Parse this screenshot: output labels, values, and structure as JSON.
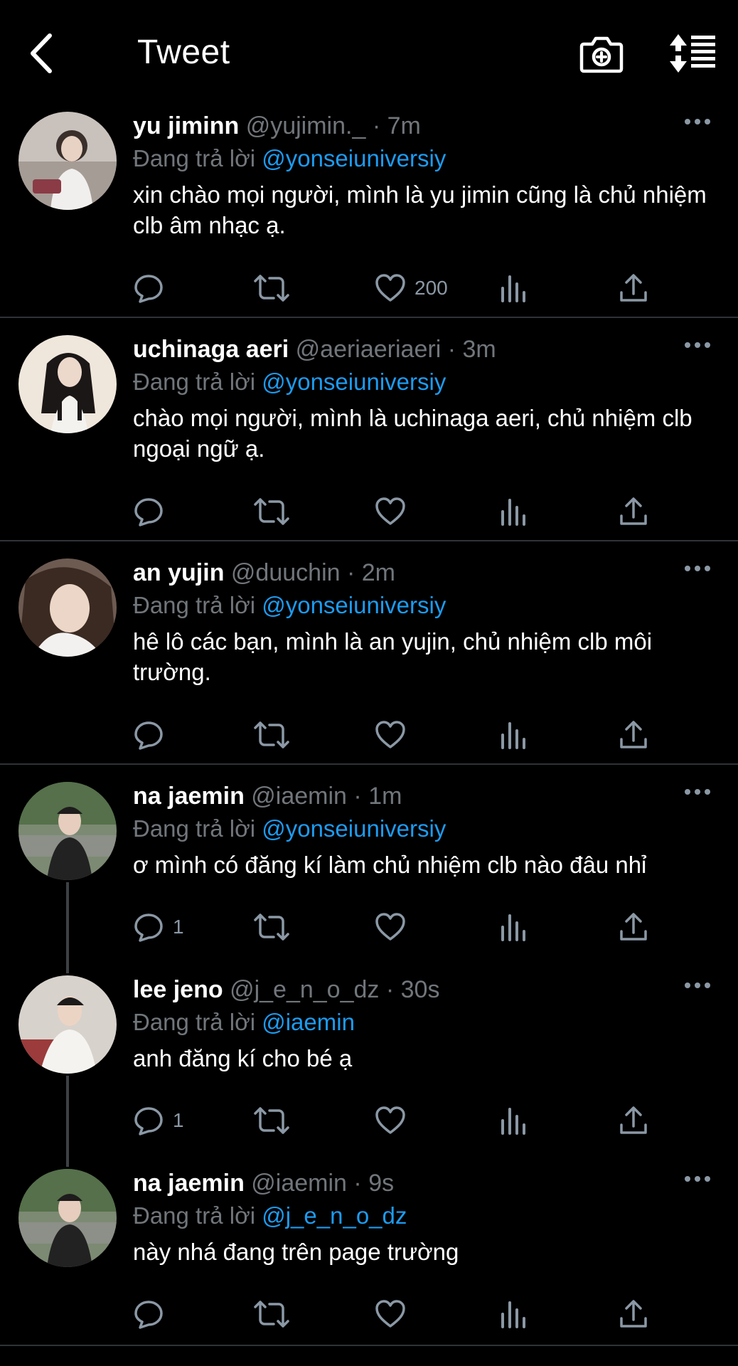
{
  "header": {
    "title": "Tweet",
    "back_icon": "back-arrow-icon",
    "camera_icon": "camera-plus-icon",
    "sort_icon": "sort-list-icon"
  },
  "colors": {
    "background": "#000000",
    "text": "#ffffff",
    "secondary": "#71767b",
    "link": "#1d9bf0",
    "divider": "#2f3336"
  },
  "tweets": [
    {
      "name": "yu jiminn",
      "handle": "@yujimin._",
      "time": "· 7m",
      "reply_prefix": "Đang trả lời",
      "reply_to": "@yonseiuniversiy",
      "text": "xin chào mọi người, mình là yu jimin cũng là chủ nhiệm clb âm nhạc ạ.",
      "reply_count": "",
      "retweet_count": "",
      "like_count": "200"
    },
    {
      "name": "uchinaga aeri",
      "handle": "@aeriaeriaeri",
      "time": "· 3m",
      "reply_prefix": "Đang trả lời",
      "reply_to": "@yonseiuniversiy",
      "text": "chào mọi người, mình là uchinaga aeri, chủ nhiệm clb ngoại ngữ ạ.",
      "reply_count": "",
      "retweet_count": "",
      "like_count": ""
    },
    {
      "name": "an yujin",
      "handle": "@duuchin",
      "time": "· 2m",
      "reply_prefix": "Đang trả lời",
      "reply_to": "@yonseiuniversiy",
      "text": "hê lô các bạn, mình là an yujin, chủ nhiệm clb môi trường.",
      "reply_count": "",
      "retweet_count": "",
      "like_count": ""
    },
    {
      "name": "na jaemin",
      "handle": "@iaemin",
      "time": "· 1m",
      "reply_prefix": "Đang trả lời",
      "reply_to": "@yonseiuniversiy",
      "text": "ơ mình có đăng kí làm chủ nhiệm clb nào đâu nhỉ",
      "reply_count": "1",
      "retweet_count": "",
      "like_count": ""
    },
    {
      "name": "lee jeno",
      "handle": "@j_e_n_o_dz",
      "time": "· 30s",
      "reply_prefix": "Đang trả lời",
      "reply_to": "@iaemin",
      "text": "anh đăng kí cho bé ạ",
      "reply_count": "1",
      "retweet_count": "",
      "like_count": ""
    },
    {
      "name": "na jaemin",
      "handle": "@iaemin",
      "time": "· 9s",
      "reply_prefix": "Đang trả lời",
      "reply_to": "@j_e_n_o_dz",
      "text": "này nhá đang trên page trường",
      "reply_count": "",
      "retweet_count": "",
      "like_count": ""
    }
  ]
}
